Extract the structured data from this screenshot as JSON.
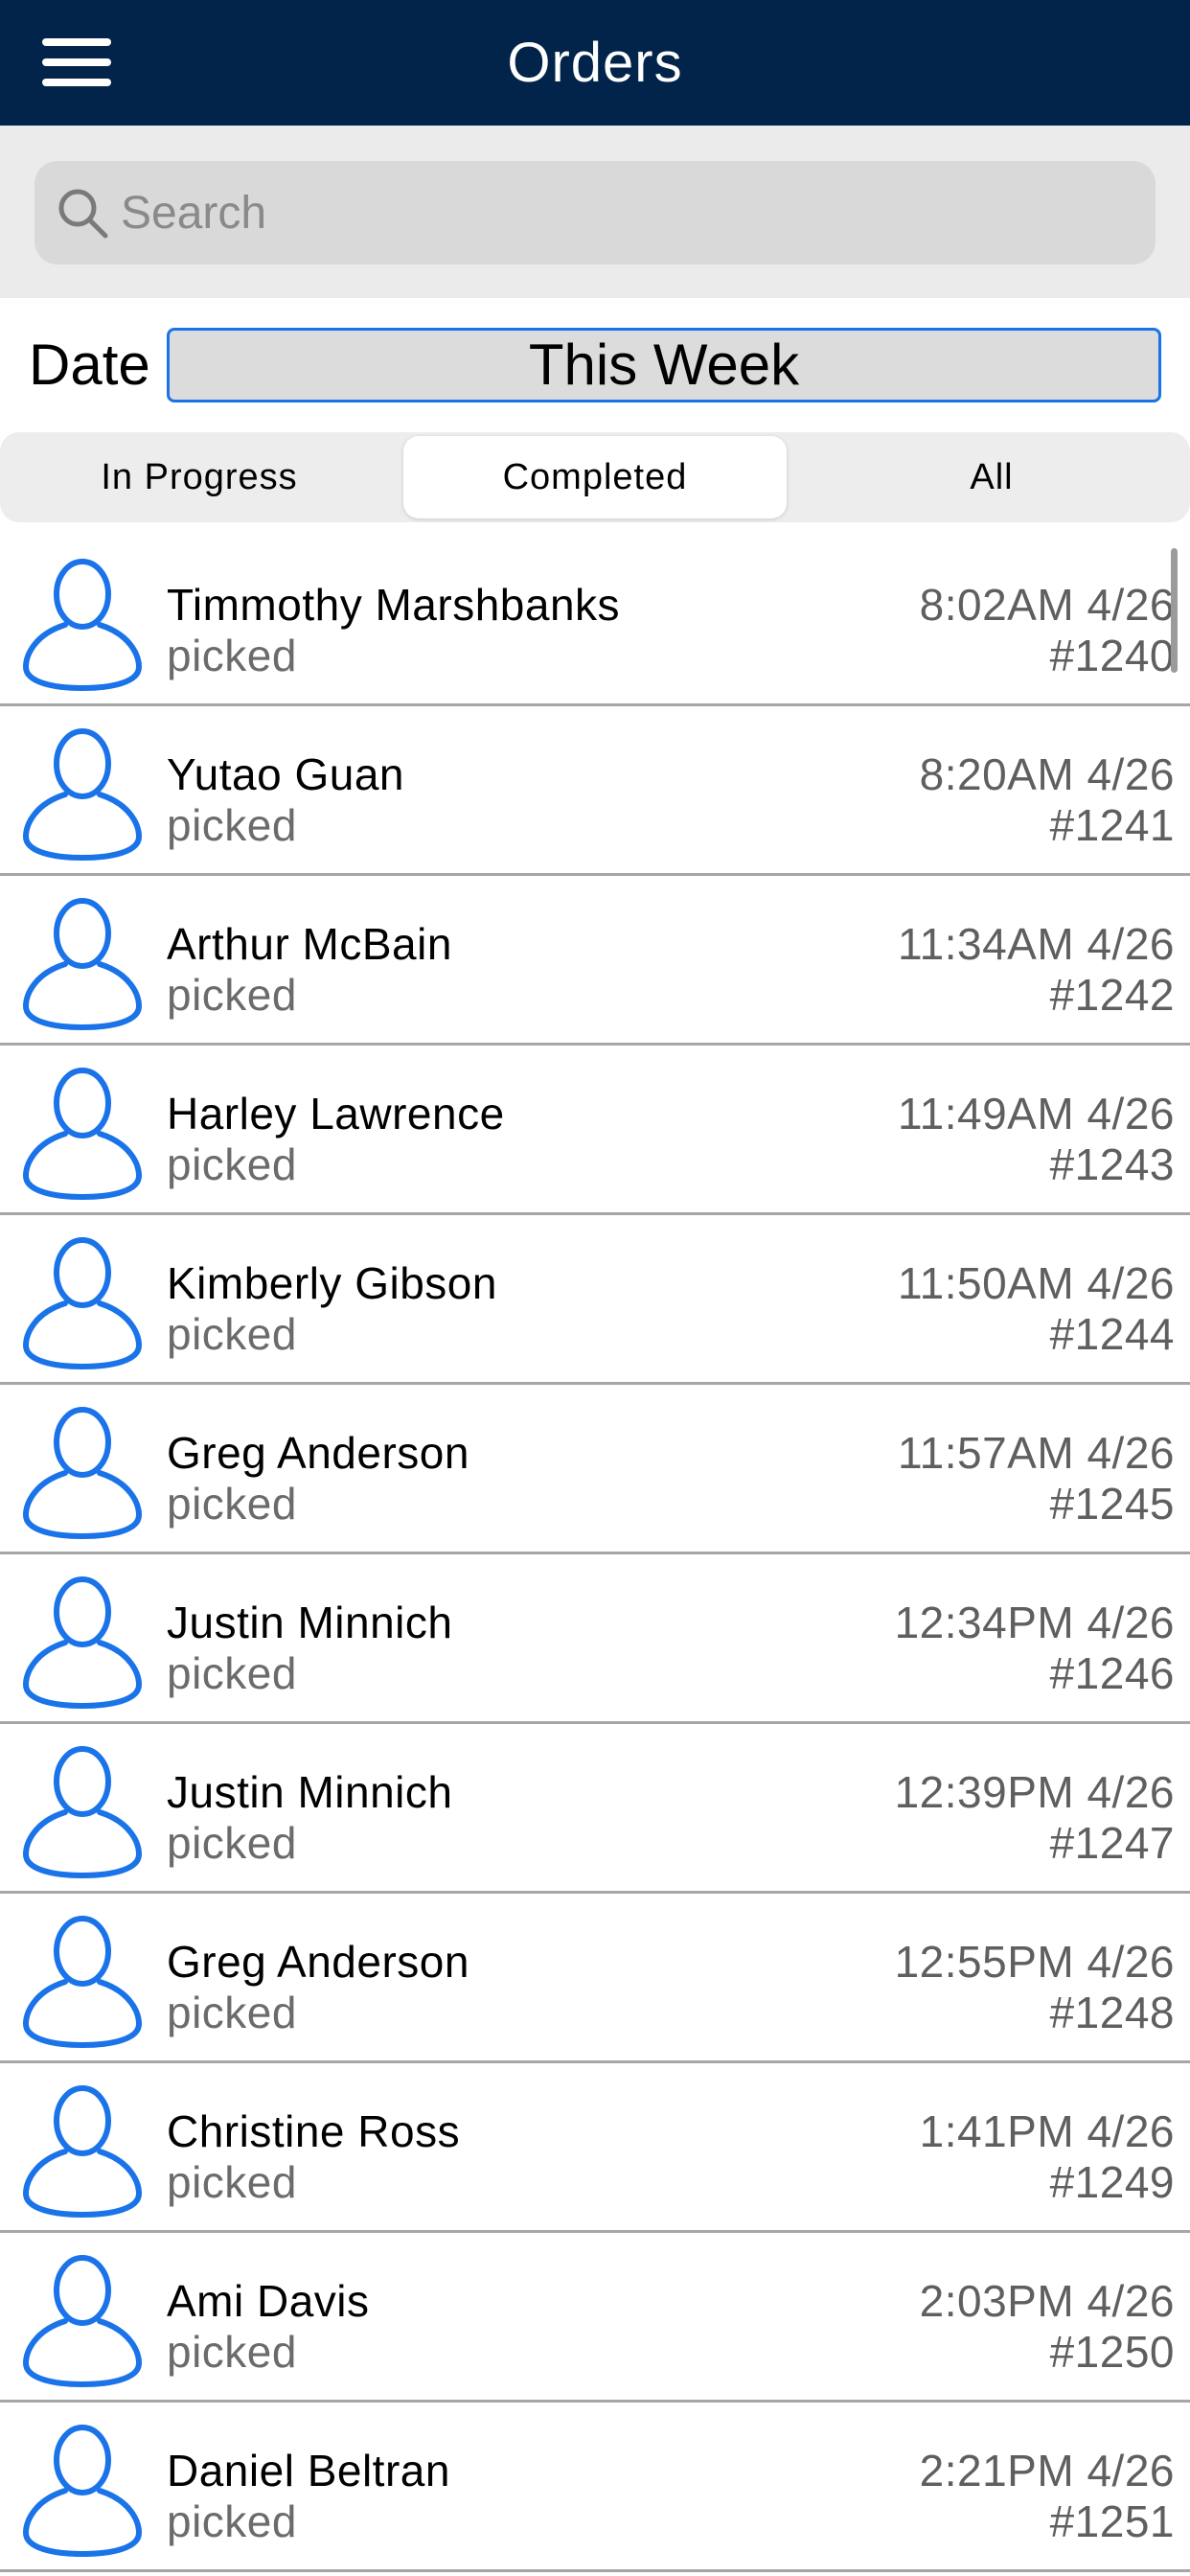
{
  "header": {
    "title": "Orders",
    "menu_icon": "hamburger-menu-icon",
    "background_color": "#02244a"
  },
  "search": {
    "placeholder": "Search",
    "value": "",
    "icon": "search-icon"
  },
  "date_filter": {
    "label": "Date",
    "value": "This Week"
  },
  "tabs": [
    {
      "label": "In Progress",
      "selected": false
    },
    {
      "label": "Completed",
      "selected": true
    },
    {
      "label": "All",
      "selected": false
    }
  ],
  "accent_color": "#1a73e8",
  "orders": [
    {
      "name": "Timmothy Marshbanks",
      "status": "picked",
      "time": "8:02AM 4/26",
      "number": "#1240"
    },
    {
      "name": "Yutao Guan",
      "status": "picked",
      "time": "8:20AM 4/26",
      "number": "#1241"
    },
    {
      "name": "Arthur McBain",
      "status": "picked",
      "time": "11:34AM 4/26",
      "number": "#1242"
    },
    {
      "name": "Harley Lawrence",
      "status": "picked",
      "time": "11:49AM 4/26",
      "number": "#1243"
    },
    {
      "name": "Kimberly Gibson",
      "status": "picked",
      "time": "11:50AM 4/26",
      "number": "#1244"
    },
    {
      "name": "Greg Anderson",
      "status": "picked",
      "time": "11:57AM 4/26",
      "number": "#1245"
    },
    {
      "name": "Justin Minnich",
      "status": "picked",
      "time": "12:34PM 4/26",
      "number": "#1246"
    },
    {
      "name": "Justin Minnich",
      "status": "picked",
      "time": "12:39PM 4/26",
      "number": "#1247"
    },
    {
      "name": "Greg Anderson",
      "status": "picked",
      "time": "12:55PM 4/26",
      "number": "#1248"
    },
    {
      "name": "Christine Ross",
      "status": "picked",
      "time": "1:41PM 4/26",
      "number": "#1249"
    },
    {
      "name": "Ami Davis",
      "status": "picked",
      "time": "2:03PM 4/26",
      "number": "#1250"
    },
    {
      "name": "Daniel Beltran",
      "status": "picked",
      "time": "2:21PM 4/26",
      "number": "#1251"
    }
  ]
}
